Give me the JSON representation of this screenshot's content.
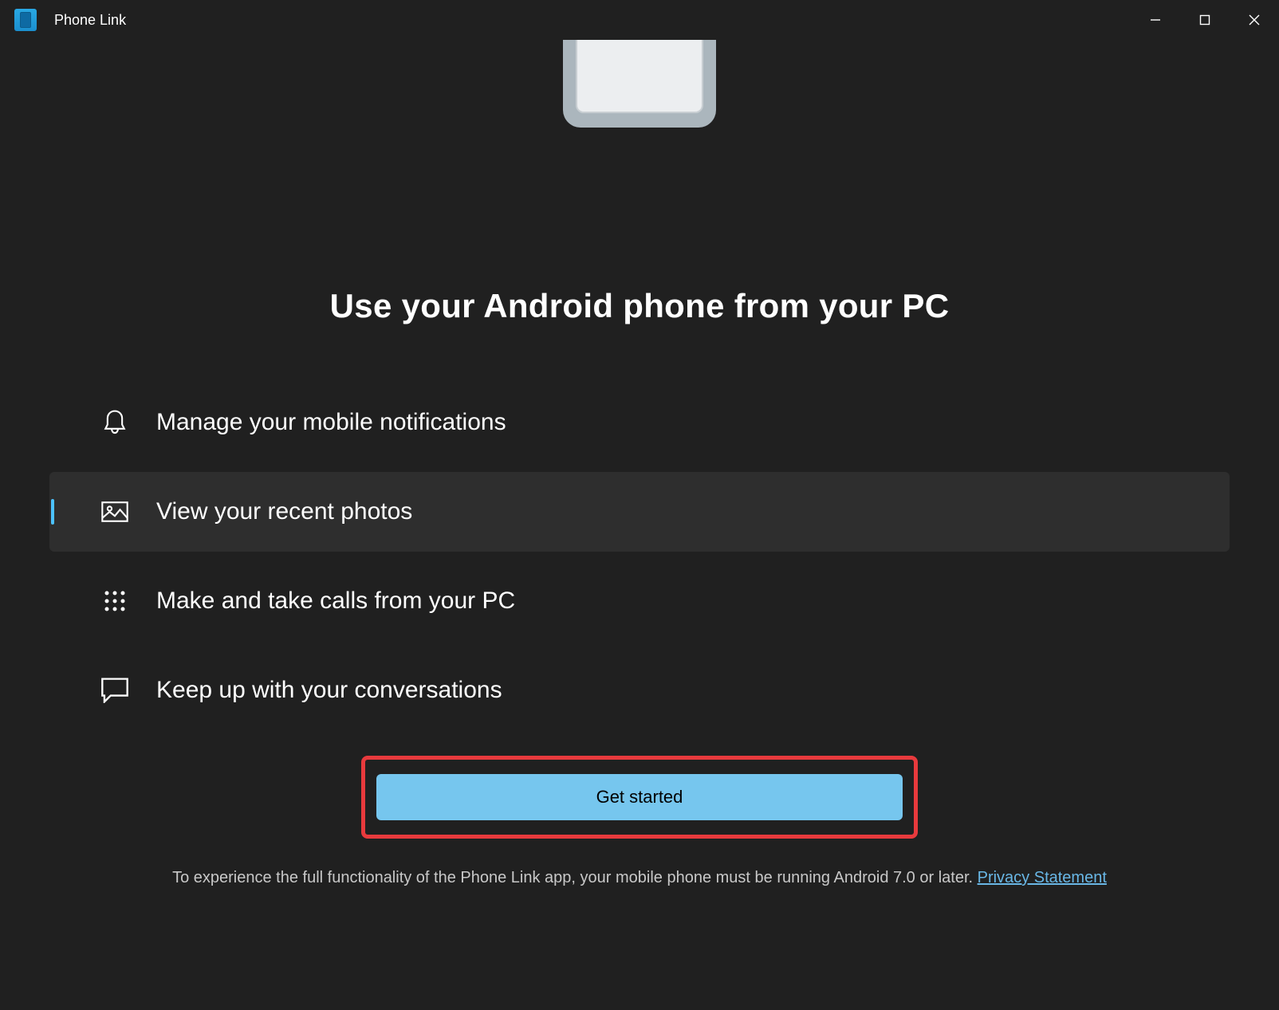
{
  "app": {
    "title": "Phone Link"
  },
  "headline": "Use your Android phone from your PC",
  "features": [
    {
      "label": "Manage your mobile notifications"
    },
    {
      "label": "View your recent photos"
    },
    {
      "label": "Make and take calls from your PC"
    },
    {
      "label": "Keep up with your conversations"
    }
  ],
  "cta": {
    "label": "Get started"
  },
  "footer": {
    "text": "To experience the full functionality of the Phone Link app, your mobile phone must be running Android 7.0 or later. ",
    "link_label": "Privacy Statement"
  }
}
